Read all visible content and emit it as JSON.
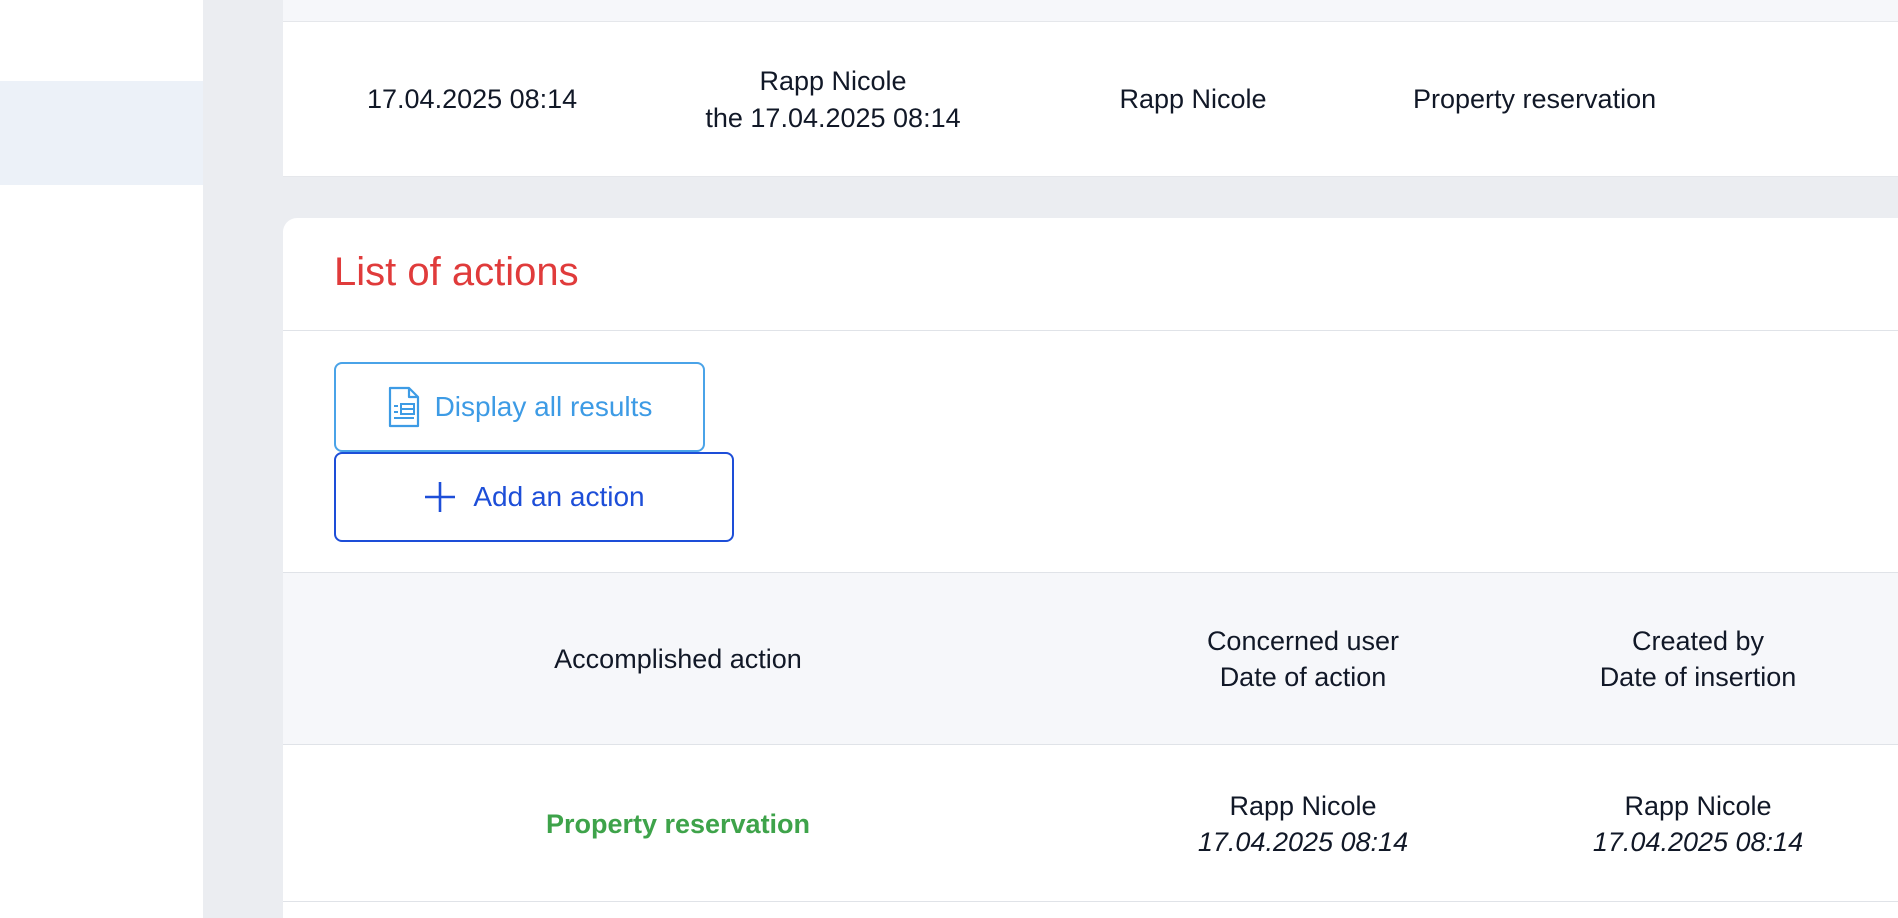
{
  "previous_entry": {
    "date": "17.04.2025 08:14",
    "created_name": "Rapp Nicole",
    "created_date_line": "the 17.04.2025 08:14",
    "user": "Rapp Nicole",
    "action": "Property reservation"
  },
  "actions_section": {
    "title": "List of actions",
    "display_all_label": "Display all results",
    "add_action_label": "Add an action",
    "table": {
      "headers": {
        "accomplished_action": "Accomplished action",
        "concerned_user": "Concerned user",
        "date_of_action": "Date of action",
        "created_by": "Created by",
        "date_of_insertion": "Date of insertion"
      },
      "rows": [
        {
          "action": "Property reservation",
          "concerned_user": "Rapp Nicole",
          "date_of_action": "17.04.2025 08:14",
          "created_by": "Rapp Nicole",
          "date_of_insertion": "17.04.2025 08:14"
        }
      ]
    }
  },
  "colors": {
    "title_red": "#e03b3b",
    "action_green": "#3ea34a",
    "display_button_blue": "#3d9be5",
    "add_button_blue": "#1d4ed8"
  },
  "icons": {
    "display_all": "document-list-icon",
    "add_action": "plus-icon"
  }
}
